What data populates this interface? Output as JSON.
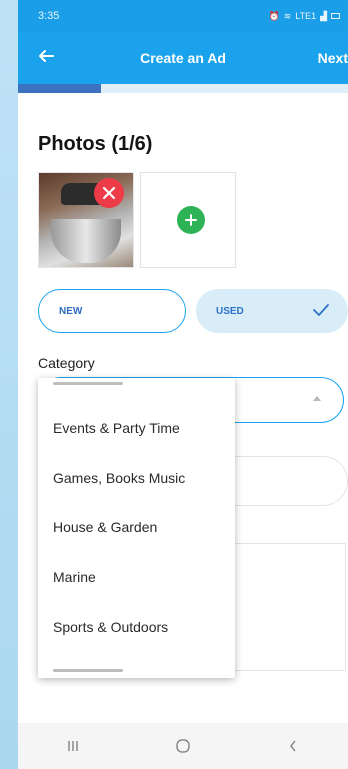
{
  "status_bar": {
    "time": "3:35",
    "signal_label": "LTE1"
  },
  "app_bar": {
    "title": "Create an Ad",
    "next_label": "Next"
  },
  "progress": {
    "fraction": 0.25,
    "track_color": "#dfeef8",
    "fill_color": "#3c72c0"
  },
  "photos": {
    "heading": "Photos (1/6)",
    "count": 1,
    "max": 6
  },
  "condition": {
    "options": [
      {
        "label": "NEW",
        "selected": false
      },
      {
        "label": "USED",
        "selected": true
      }
    ]
  },
  "category": {
    "label": "Category",
    "dropdown_items": [
      "Events & Party Time",
      "Games, Books Music",
      "House & Garden",
      "Marine",
      "Sports & Outdoors"
    ]
  },
  "colors": {
    "primary": "#1aa3ec",
    "status_bar": "#1a9ee8",
    "remove": "#ee3b48",
    "add": "#2db356",
    "accent_text": "#2e6bbf"
  },
  "icons": {
    "back": "arrow-left-icon",
    "remove": "close-icon",
    "add": "plus-icon",
    "check": "check-icon",
    "nav_recents": "recents-icon",
    "nav_home": "home-icon",
    "nav_back": "chevron-left-icon"
  }
}
